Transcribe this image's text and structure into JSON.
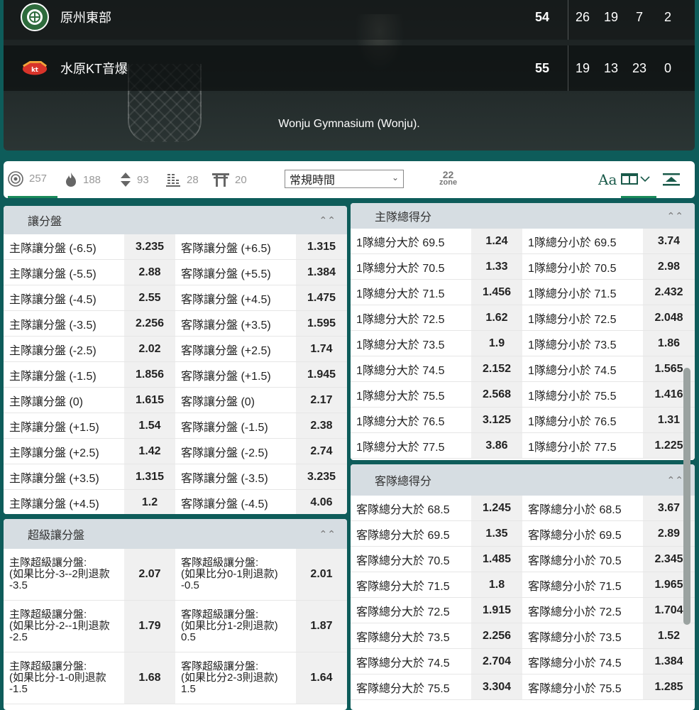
{
  "scoreboard": {
    "teams": [
      {
        "name": "原州東部",
        "total": "54",
        "quarters": [
          "26",
          "19",
          "7",
          "2"
        ],
        "logo": "dongbu-logo"
      },
      {
        "name": "水原KT音爆",
        "total": "55",
        "quarters": [
          "19",
          "13",
          "23",
          "0"
        ],
        "logo": "kt-sonicboom-logo"
      }
    ],
    "venue": "Wonju Gymnasium (Wonju)."
  },
  "toolbar": {
    "tabs": [
      {
        "icon": "target-icon",
        "count": "257"
      },
      {
        "icon": "fire-icon",
        "count": "188"
      },
      {
        "icon": "updown-icon",
        "count": "93"
      },
      {
        "icon": "ladder-icon",
        "count": "28"
      },
      {
        "icon": "gate-icon",
        "count": "20"
      }
    ],
    "period_select": "常規時間",
    "zone_number": "22",
    "zone_label": "zone",
    "font_icon_label": "Aa"
  },
  "handicap": {
    "title": "讓分盤",
    "rows": [
      [
        "主隊讓分盤 (-6.5)",
        "3.235",
        "客隊讓分盤 (+6.5)",
        "1.315"
      ],
      [
        "主隊讓分盤 (-5.5)",
        "2.88",
        "客隊讓分盤 (+5.5)",
        "1.384"
      ],
      [
        "主隊讓分盤 (-4.5)",
        "2.55",
        "客隊讓分盤 (+4.5)",
        "1.475"
      ],
      [
        "主隊讓分盤 (-3.5)",
        "2.256",
        "客隊讓分盤 (+3.5)",
        "1.595"
      ],
      [
        "主隊讓分盤 (-2.5)",
        "2.02",
        "客隊讓分盤 (+2.5)",
        "1.74"
      ],
      [
        "主隊讓分盤 (-1.5)",
        "1.856",
        "客隊讓分盤 (+1.5)",
        "1.945"
      ],
      [
        "主隊讓分盤 (0)",
        "1.615",
        "客隊讓分盤 (0)",
        "2.17"
      ],
      [
        "主隊讓分盤 (+1.5)",
        "1.54",
        "客隊讓分盤 (-1.5)",
        "2.38"
      ],
      [
        "主隊讓分盤 (+2.5)",
        "1.42",
        "客隊讓分盤 (-2.5)",
        "2.74"
      ],
      [
        "主隊讓分盤 (+3.5)",
        "1.315",
        "客隊讓分盤 (-3.5)",
        "3.235"
      ],
      [
        "主隊讓分盤 (+4.5)",
        "1.2",
        "客隊讓分盤 (-4.5)",
        "4.06"
      ]
    ]
  },
  "super_handicap": {
    "title": "超級讓分盤",
    "rows": [
      [
        "主隊超級讓分盤:\n(如果比分-3--2則退款\n-3.5",
        "2.07",
        "客隊超級讓分盤:\n(如果比分0-1則退款)\n-0.5",
        "2.01"
      ],
      [
        "主隊超級讓分盤:\n(如果比分-2--1則退款\n-2.5",
        "1.79",
        "客隊超級讓分盤:\n(如果比分1-2則退款)\n0.5",
        "1.87"
      ],
      [
        "主隊超級讓分盤:\n(如果比分-1-0則退款\n-1.5",
        "1.68",
        "客隊超級讓分盤:\n(如果比分2-3則退款)\n1.5",
        "1.64"
      ]
    ]
  },
  "home_total": {
    "title": "主隊總得分",
    "rows": [
      [
        "1隊總分大於 69.5",
        "1.24",
        "1隊總分小於 69.5",
        "3.74"
      ],
      [
        "1隊總分大於 70.5",
        "1.33",
        "1隊總分小於 70.5",
        "2.98"
      ],
      [
        "1隊總分大於 71.5",
        "1.456",
        "1隊總分小於 71.5",
        "2.432"
      ],
      [
        "1隊總分大於 72.5",
        "1.62",
        "1隊總分小於 72.5",
        "2.048"
      ],
      [
        "1隊總分大於 73.5",
        "1.9",
        "1隊總分小於 73.5",
        "1.86"
      ],
      [
        "1隊總分大於 74.5",
        "2.152",
        "1隊總分小於 74.5",
        "1.565"
      ],
      [
        "1隊總分大於 75.5",
        "2.568",
        "1隊總分小於 75.5",
        "1.416"
      ],
      [
        "1隊總分大於 76.5",
        "3.125",
        "1隊總分小於 76.5",
        "1.31"
      ],
      [
        "1隊總分大於 77.5",
        "3.86",
        "1隊總分小於 77.5",
        "1.225"
      ]
    ]
  },
  "away_total": {
    "title": "客隊總得分",
    "rows": [
      [
        "客隊總分大於 68.5",
        "1.245",
        "客隊總分小於 68.5",
        "3.67"
      ],
      [
        "客隊總分大於 69.5",
        "1.35",
        "客隊總分小於 69.5",
        "2.89"
      ],
      [
        "客隊總分大於 70.5",
        "1.485",
        "客隊總分小於 70.5",
        "2.345"
      ],
      [
        "客隊總分大於 71.5",
        "1.8",
        "客隊總分小於 71.5",
        "1.965"
      ],
      [
        "客隊總分大於 72.5",
        "1.915",
        "客隊總分小於 72.5",
        "1.704"
      ],
      [
        "客隊總分大於 73.5",
        "2.256",
        "客隊總分小於 73.5",
        "1.52"
      ],
      [
        "客隊總分大於 74.5",
        "2.704",
        "客隊總分小於 74.5",
        "1.384"
      ],
      [
        "客隊總分大於 75.5",
        "3.304",
        "客隊總分小於 75.5",
        "1.285"
      ]
    ]
  },
  "colors": {
    "accent": "#1a8a5a",
    "background": "#0e5c5a",
    "header_gray": "#d6dde2"
  }
}
